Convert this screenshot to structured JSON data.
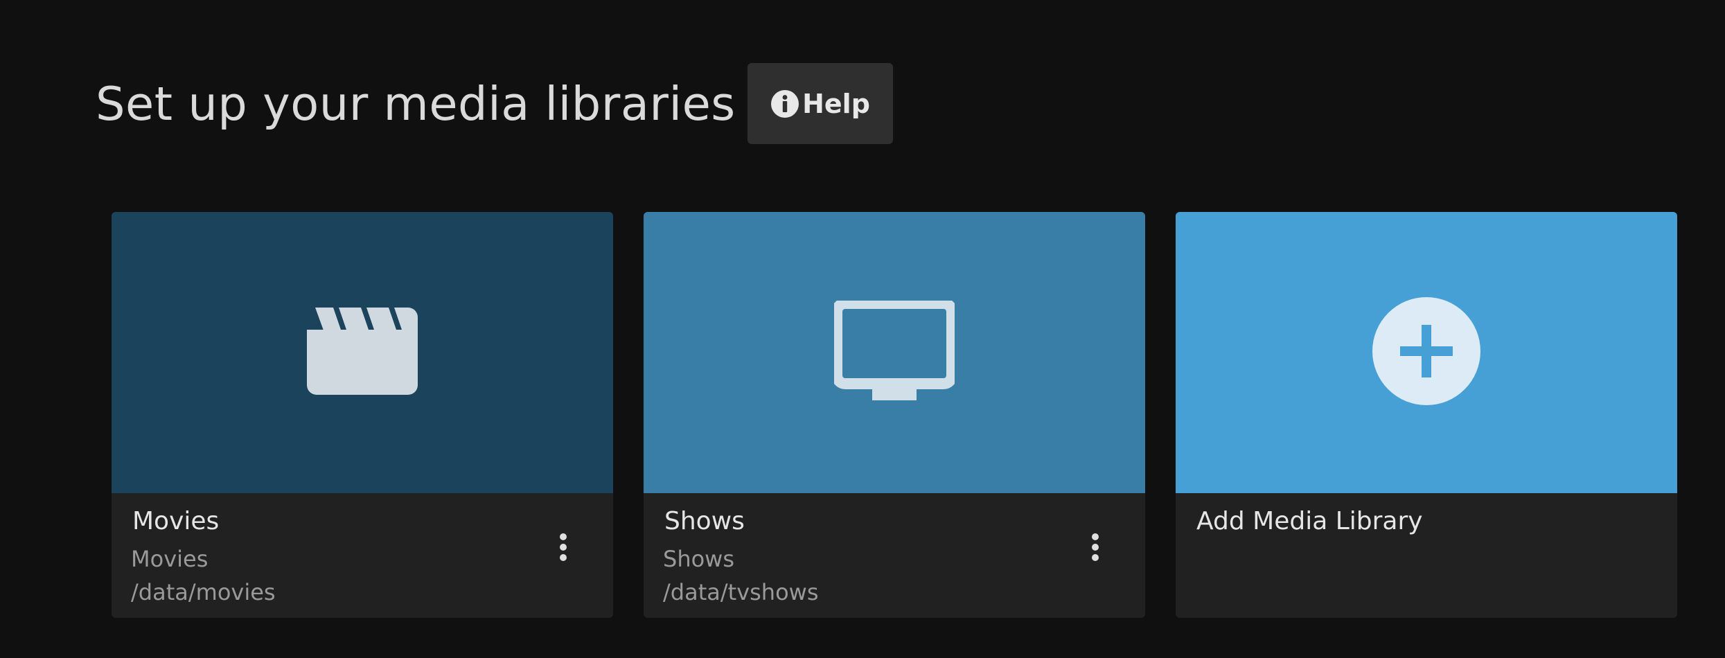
{
  "header": {
    "title": "Set up your media libraries",
    "help_label": "Help",
    "help_icon": "info-circle-icon"
  },
  "libraries": [
    {
      "name": "Movies",
      "type": "Movies",
      "path": "/data/movies",
      "icon": "clapperboard-icon",
      "color": "#1c435c"
    },
    {
      "name": "Shows",
      "type": "Shows",
      "path": "/data/tvshows",
      "icon": "tv-icon",
      "color": "#387ea7"
    }
  ],
  "add_card": {
    "label": "Add Media Library",
    "icon": "add-circle-icon",
    "color": "#46a0d6"
  }
}
